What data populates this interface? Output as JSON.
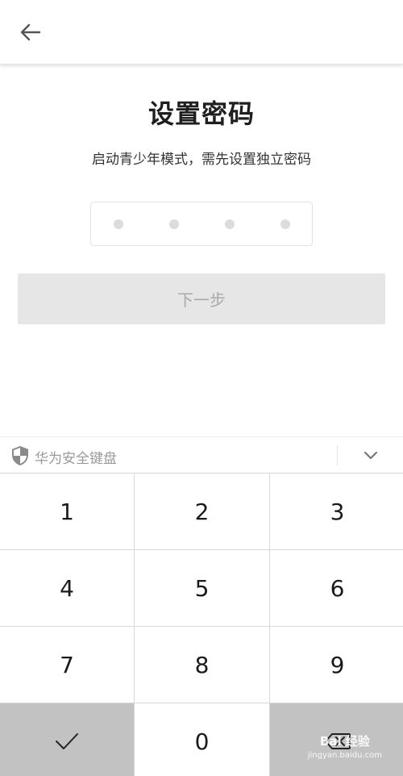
{
  "header": {
    "back_icon": "arrow-left-icon"
  },
  "main": {
    "title": "设置密码",
    "subtitle": "启动青少年模式，需先设置独立密码",
    "pin_length": 4,
    "pin_filled": 0,
    "next_label": "下一步"
  },
  "keyboard": {
    "name": "华为安全键盘",
    "shield_icon": "shield-icon",
    "collapse_icon": "chevron-down-icon",
    "keys": [
      "1",
      "2",
      "3",
      "4",
      "5",
      "6",
      "7",
      "8",
      "9"
    ],
    "zero": "0",
    "confirm_icon": "checkmark-icon",
    "delete_icon": "backspace-icon"
  },
  "watermark": {
    "logo": "Bai 经验",
    "url": "jingyan.baidu.com"
  },
  "colors": {
    "keypad_action_bg": "#c2c2c2",
    "button_disabled_bg": "#e6e6e6"
  }
}
